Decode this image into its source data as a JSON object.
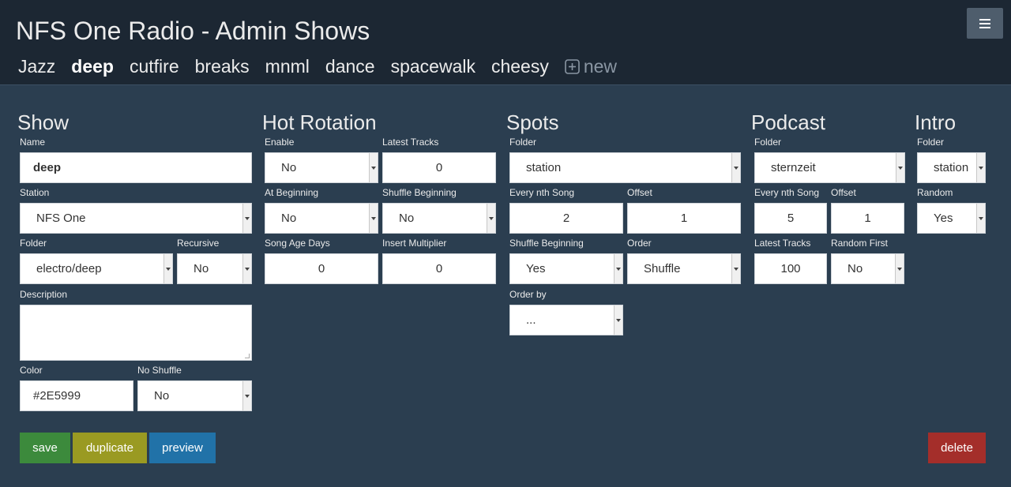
{
  "app": {
    "title": "NFS One Radio - Admin Shows",
    "menu_icon": "hamburger-icon"
  },
  "tabs": [
    {
      "label": "Jazz",
      "active": false
    },
    {
      "label": "deep",
      "active": true
    },
    {
      "label": "cutfire",
      "active": false
    },
    {
      "label": "breaks",
      "active": false
    },
    {
      "label": "mnml",
      "active": false
    },
    {
      "label": "dance",
      "active": false
    },
    {
      "label": "spacewalk",
      "active": false
    },
    {
      "label": "cheesy",
      "active": false
    }
  ],
  "new_tab": {
    "label": "new",
    "icon": "plus-square-icon"
  },
  "show": {
    "heading": "Show",
    "name_label": "Name",
    "name_value": "deep",
    "station_label": "Station",
    "station_value": "NFS One",
    "folder_label": "Folder",
    "folder_value": "electro/deep",
    "recursive_label": "Recursive",
    "recursive_value": "No",
    "description_label": "Description",
    "description_value": "",
    "color_label": "Color",
    "color_value": "#2E5999",
    "noshuffle_label": "No Shuffle",
    "noshuffle_value": "No"
  },
  "hot_rotation": {
    "heading": "Hot Rotation",
    "enable_label": "Enable",
    "enable_value": "No",
    "latest_tracks_label": "Latest Tracks",
    "latest_tracks_value": "0",
    "at_beginning_label": "At Beginning",
    "at_beginning_value": "No",
    "shuffle_beginning_label": "Shuffle Beginning",
    "shuffle_beginning_value": "No",
    "song_age_label": "Song Age Days",
    "song_age_value": "0",
    "insert_multiplier_label": "Insert Multiplier",
    "insert_multiplier_value": "0"
  },
  "spots": {
    "heading": "Spots",
    "folder_label": "Folder",
    "folder_value": "station",
    "every_nth_label": "Every nth Song",
    "every_nth_value": "2",
    "offset_label": "Offset",
    "offset_value": "1",
    "shuffle_beginning_label": "Shuffle Beginning",
    "shuffle_beginning_value": "Yes",
    "order_label": "Order",
    "order_value": "Shuffle",
    "order_by_label": "Order by",
    "order_by_value": "..."
  },
  "podcast": {
    "heading": "Podcast",
    "folder_label": "Folder",
    "folder_value": "sternzeit",
    "every_nth_label": "Every nth Song",
    "every_nth_value": "5",
    "offset_label": "Offset",
    "offset_value": "1",
    "latest_tracks_label": "Latest Tracks",
    "latest_tracks_value": "100",
    "random_first_label": "Random First",
    "random_first_value": "No"
  },
  "intro": {
    "heading": "Intro",
    "folder_label": "Folder",
    "folder_value": "station",
    "random_label": "Random",
    "random_value": "Yes"
  },
  "actions": {
    "save": "save",
    "duplicate": "duplicate",
    "preview": "preview",
    "delete": "delete"
  },
  "colors": {
    "background": "#2b3e50",
    "topbar": "#1c2733",
    "save": "#3c8a3c",
    "duplicate": "#9a9a22",
    "preview": "#2172a8",
    "delete": "#a42e2a"
  }
}
